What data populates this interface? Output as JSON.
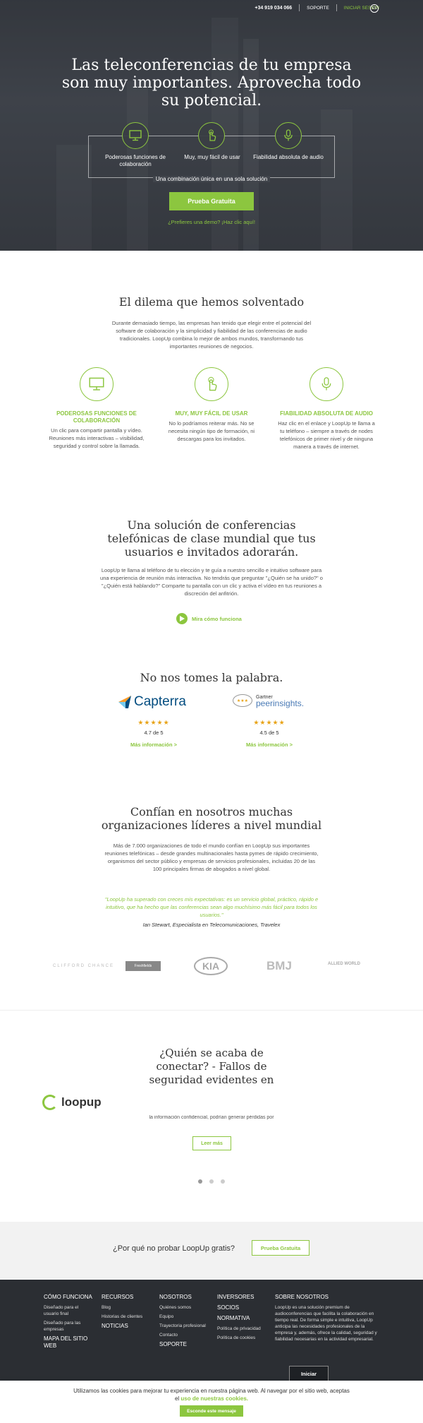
{
  "topnav": {
    "phone": "+34 919 034 066",
    "support": "SOPORTE",
    "login": "INICIAR SESIÓN",
    "lang": "ES"
  },
  "hero": {
    "title": "Las teleconferencias de tu empresa son muy importantes. Aprovecha todo su potencial.",
    "features": [
      {
        "label": "Poderosas funciones de colaboración",
        "icon": "monitor-icon"
      },
      {
        "label": "Muy, muy fácil de usar",
        "icon": "hand-pointer-icon"
      },
      {
        "label": "Fiabilidad absoluta de audio",
        "icon": "microphone-icon"
      }
    ],
    "box_caption": "Una combinación única en una sola solución",
    "cta": "Prueba Gratuita",
    "demo_link": "¿Prefieres una demo? ¡Haz clic aquí!"
  },
  "dilemma": {
    "title": "El dilema que hemos solventado",
    "body": "Durante demasiado tiempo, las empresas han tenido que elegir entre el potencial del software de colaboración y la simplicidad y fiabilidad de las conferencias de audio tradicionales. LoopUp combina lo mejor de ambos mundos, transformando tus importantes reuniones de negocios.",
    "columns": [
      {
        "heading": "PODEROSAS FUNCIONES DE COLABORACIÓN",
        "body": "Un clic para compartir pantalla y vídeo. Reuniones más interactivas – visibilidad, seguridad y control sobre la llamada.",
        "icon": "monitor-icon"
      },
      {
        "heading": "MUY, MUY FÁCIL DE USAR",
        "body": "No lo podríamos reiterar más. No se necesita ningún tipo de formación, ni descargas para los invitados.",
        "icon": "hand-pointer-icon"
      },
      {
        "heading": "FIABILIDAD ABSOLUTA DE AUDIO",
        "body": "Haz clic en el enlace y LoopUp te llama a tu teléfono – siempre a través de nodes telefónicos de primer nivel y de ninguna manera a través de internet.",
        "icon": "microphone-icon"
      }
    ]
  },
  "solution": {
    "title": "Una solución de conferencias telefónicas de clase mundial que tus usuarios e invitados adorarán.",
    "body": "LoopUp te llama al teléfono de tu elección y te guía a nuestro sencillo e intuitivo software para una experiencia de reunión más interactiva. No tendrás que preguntar \"¿Quién se ha unido?\" o \"¿Quién está hablando?\" Comparte tu pantalla con un clic y activa el vídeo en tus reuniones a discreción del anfitrión.",
    "play_label": "Mira cómo funciona"
  },
  "reviews": {
    "title": "No nos tomes la palabra.",
    "items": [
      {
        "brand": "Capterra",
        "stars": "★★★★★",
        "score": "4.7 de 5",
        "more": "Más información >",
        "rating": 4.7
      },
      {
        "brand_top": "Gartner",
        "brand": "peerinsights.",
        "stars": "★★★★★",
        "score": "4.5 de 5",
        "more": "Más información >",
        "rating": 4.5
      }
    ]
  },
  "trust": {
    "title": "Confían en nosotros muchas organizaciones líderes a nivel mundial",
    "body": "Más de 7.000 organizaciones de todo el mundo confían en LoopUp sus importantes reuniones telefónicas – desde grandes multinacionales hasta pymes de rápido crecimiento, organismos del sector público y empresas de servicios profesionales, incluidas 20 de las 100 principales firmas de abogados a nivel global.",
    "quote": "\"LoopUp ha superado con creces mis expectativas: es un servicio global, práctico, rápido e intuitivo, que ha hecho que las conferencias sean algo muchísimo más fácil para todos los usuarios.\"",
    "author": "Ian Stewart, Especialista en Telecomunicaciones, Travelex",
    "logos": [
      "CLIFFORD CHANCE",
      "Freshfields",
      "KIA",
      "BMJ",
      "ALLIED WORLD"
    ]
  },
  "blog": {
    "title": "¿Quién se acaba de conectar? - Fallos de seguridad evidentes en las empresas",
    "logo": "loopup",
    "excerpt": "la información confidencial, podrían generar pérdidas por",
    "read_more": "Leer más"
  },
  "try": {
    "text": "¿Por qué no probar LoopUp gratis?",
    "button": "Prueba Gratuita"
  },
  "footer": {
    "col1": [
      "CÓMO FUNCIONA",
      "Diseñado para el usuario final",
      "Diseñado para las empresas",
      "MAPA DEL SITIO WEB"
    ],
    "col2": [
      "RECURSOS",
      "Blog",
      "Historias de clientes",
      "NOTICIAS"
    ],
    "col3": [
      "NOSOTROS",
      "Quiénes somos",
      "Equipo",
      "Trayectoria profesional",
      "Contacto",
      "SOPORTE"
    ],
    "col4": [
      "INVERSORES",
      "SOCIOS",
      "NORMATIVA",
      "Política de privacidad",
      "Política de cookies"
    ],
    "about_title": "SOBRE NOSOTROS",
    "about_text": "LoopUp es una solución premium de audioconferencias que facilita la colaboración en tiempo real. De forma simple e intuitiva, LoopUp anticipa las necesidades profesionales de la empresa y, además, ofrece la calidad, seguridad y fiabilidad necesarias en la actividad empresarial.",
    "login": "Iniciar"
  },
  "cookie": {
    "text": "Utilizamos las cookies para mejorar tu experiencia en nuestra página web. Al navegar por el sitio web, aceptas el ",
    "link": "uso de nuestras cookies.",
    "button": "Esconde este mensaje"
  },
  "colors": {
    "accent": "#8cc63f",
    "hero_bg": "#3a3e45",
    "footer_bg": "#2b2e33"
  }
}
